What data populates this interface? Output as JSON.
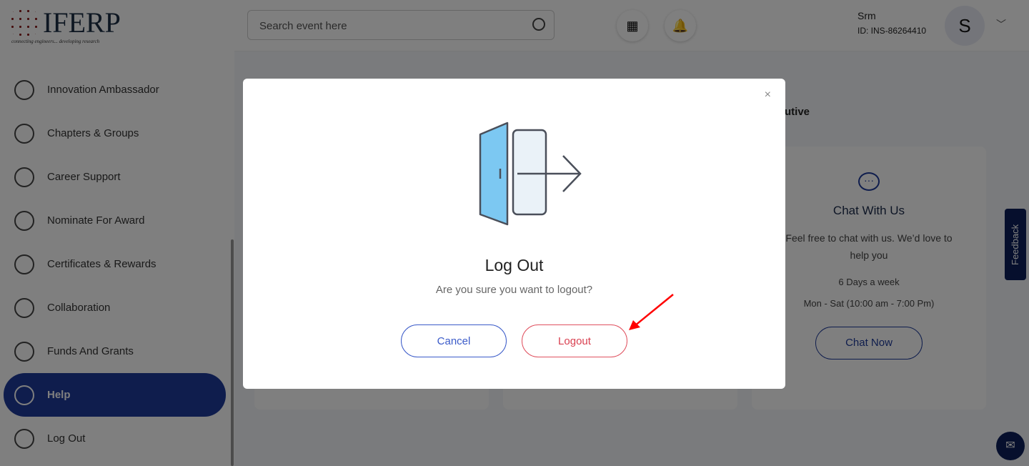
{
  "logo": {
    "text": "IFERP",
    "tagline": "connecting engineers... developing research"
  },
  "sidebar": {
    "items": [
      {
        "label": "Innovation Ambassador",
        "icon": "ambassador-icon"
      },
      {
        "label": "Chapters & Groups",
        "icon": "groups-icon"
      },
      {
        "label": "Career Support",
        "icon": "career-icon"
      },
      {
        "label": "Nominate For Award",
        "icon": "award-icon"
      },
      {
        "label": "Certificates & Rewards",
        "icon": "certificate-icon"
      },
      {
        "label": "Collaboration",
        "icon": "handshake-icon"
      },
      {
        "label": "Funds And Grants",
        "icon": "funds-icon"
      },
      {
        "label": "Help",
        "icon": "headset-icon",
        "active": true
      },
      {
        "label": "Log Out",
        "icon": "logout-icon"
      }
    ]
  },
  "topbar": {
    "search_placeholder": "Search event here",
    "user_name": "Srm",
    "user_id": "ID: INS-86264410",
    "avatar": "S"
  },
  "main": {
    "heading_fragment": "utive",
    "chat_card": {
      "title": "Chat With Us",
      "desc": "Feel free to chat with us. We’d love to help you",
      "days": "6 Days a week",
      "hours": "Mon - Sat (10:00 am - 7:00 Pm)",
      "button": "Chat Now"
    }
  },
  "feedback": "Feedback",
  "modal": {
    "title": "Log Out",
    "question": "Are you sure you want to logout?",
    "cancel": "Cancel",
    "logout": "Logout",
    "close": "×"
  },
  "colors": {
    "primary": "#1e3a9a",
    "danger": "#e05260",
    "annotation": "#ff0000"
  }
}
